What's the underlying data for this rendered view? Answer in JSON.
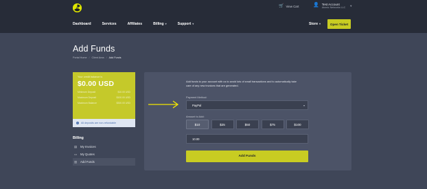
{
  "header": {
    "logo_name": "radiation-logo",
    "cart_label": "View Cart",
    "account": {
      "name": "Test Account",
      "company": "Atomic Networks LLC"
    }
  },
  "nav": {
    "items": [
      {
        "label": "Dashboard",
        "has_dropdown": false
      },
      {
        "label": "Services",
        "has_dropdown": false
      },
      {
        "label": "Affiliates",
        "has_dropdown": false
      },
      {
        "label": "Billing",
        "has_dropdown": true
      },
      {
        "label": "Support",
        "has_dropdown": true
      }
    ],
    "store_label": "Store",
    "open_ticket_label": "Open Ticket"
  },
  "page": {
    "title": "Add Funds",
    "breadcrumb": [
      "Portal Home",
      "Client Area",
      "Add Funds"
    ]
  },
  "credit": {
    "label": "Your credit balance is",
    "amount": "$0.00 USD",
    "rows": [
      {
        "label": "Minimum Deposit",
        "value": "$10.00 USD"
      },
      {
        "label": "Maximum Deposit",
        "value": "$100.00 USD"
      },
      {
        "label": "Maximum Balance",
        "value": "$300.00 USD"
      }
    ],
    "notice": "All deposits are non-refundable"
  },
  "billing": {
    "title": "Billing",
    "items": [
      {
        "label": "My Invoices",
        "icon": "invoice-icon"
      },
      {
        "label": "My Quotes",
        "icon": "quotes-icon"
      },
      {
        "label": "Add Funds",
        "icon": "add-funds-icon",
        "active": true
      }
    ]
  },
  "form": {
    "intro": "Add funds to your account with us to avoid lots of small transactions and to automatically take care of any new invoices that are generated.",
    "payment_method_label": "Payment Method:",
    "payment_method_value": "PayPal",
    "amount_label": "Amount to Add:",
    "amount_options": [
      "$10",
      "$25",
      "$50",
      "$75",
      "$100"
    ],
    "selected_amount": "$10",
    "amount_value": "10.00",
    "submit_label": "Add Funds"
  },
  "colors": {
    "accent": "#c8cc22",
    "annotation_arrow": "#f2e600",
    "topbar": "#272c38",
    "background": "#3f4658"
  }
}
